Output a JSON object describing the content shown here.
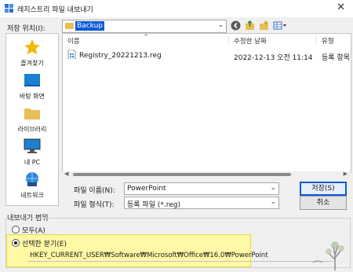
{
  "window": {
    "title": "레지스트리 파일 내보내기",
    "close_glyph": "✕"
  },
  "lookin": {
    "label": "저장 위치(I):",
    "value": "Backup"
  },
  "toolbar": {
    "icons": [
      "back-icon",
      "up-folder-icon",
      "new-folder-icon",
      "view-menu-icon"
    ]
  },
  "places": [
    {
      "label": "즐겨찾기",
      "icon": "star-icon"
    },
    {
      "label": "바탕 화면",
      "icon": "desktop-icon"
    },
    {
      "label": "라이브러리",
      "icon": "library-folder-icon"
    },
    {
      "label": "내 PC",
      "icon": "computer-icon"
    },
    {
      "label": "네트워크",
      "icon": "network-icon"
    }
  ],
  "filelist": {
    "columns": [
      "이름",
      "수정한 날짜",
      "유형"
    ],
    "rows": [
      {
        "name": "Registry_20221213.reg",
        "date": "2022-12-13 오전 11:14",
        "type": "등록 항목"
      }
    ]
  },
  "filename": {
    "label": "파일 이름(N):",
    "value": "PowerPoint"
  },
  "filetype": {
    "label": "파일 형식(T):",
    "value": "등록 파일 (*.reg)"
  },
  "buttons": {
    "save": "저장(S)",
    "cancel": "취소"
  },
  "export_range": {
    "label": "내보내기 범위",
    "option_all": "모두(A)",
    "option_selected": "선택한 분기(E)",
    "selected_option": "selected",
    "branch_path": "HKEY_CURRENT_USER₩Software₩Microsoft₩Office₩16.0₩PowerPoint"
  },
  "colors": {
    "highlight": "#fff9a6",
    "selection": "#0a5ad8",
    "folder": "#e7be55"
  }
}
